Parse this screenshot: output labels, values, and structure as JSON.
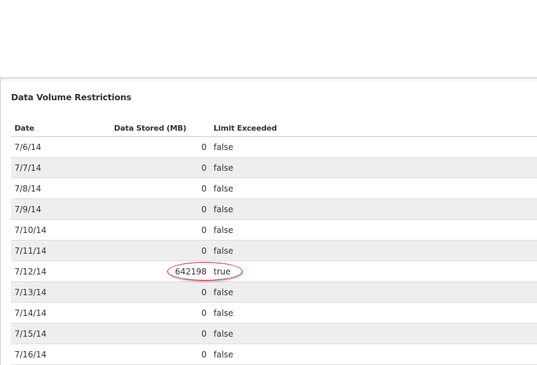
{
  "section": {
    "title": "Data Volume Restrictions"
  },
  "table": {
    "headers": {
      "date": "Date",
      "stored": "Data Stored (MB)",
      "limit": "Limit Exceeded"
    },
    "rows": [
      {
        "date": "7/6/14",
        "stored": "0",
        "limit": "false"
      },
      {
        "date": "7/7/14",
        "stored": "0",
        "limit": "false"
      },
      {
        "date": "7/8/14",
        "stored": "0",
        "limit": "false"
      },
      {
        "date": "7/9/14",
        "stored": "0",
        "limit": "false"
      },
      {
        "date": "7/10/14",
        "stored": "0",
        "limit": "false"
      },
      {
        "date": "7/11/14",
        "stored": "0",
        "limit": "false"
      },
      {
        "date": "7/12/14",
        "stored": "642198",
        "limit": "true"
      },
      {
        "date": "7/13/14",
        "stored": "0",
        "limit": "false"
      },
      {
        "date": "7/14/14",
        "stored": "0",
        "limit": "false"
      },
      {
        "date": "7/15/14",
        "stored": "0",
        "limit": "false"
      },
      {
        "date": "7/16/14",
        "stored": "0",
        "limit": "false"
      }
    ]
  },
  "colors": {
    "highlight": "#c0262c",
    "stripe": "#eeeeee"
  }
}
